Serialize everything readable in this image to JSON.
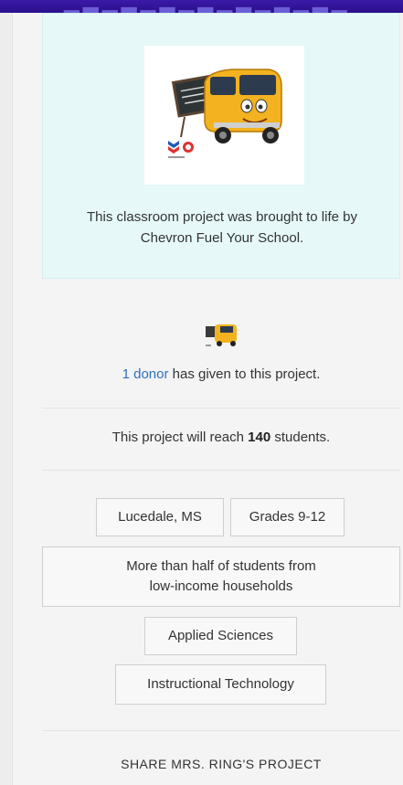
{
  "sponsor": {
    "description": "This classroom project was brought to life by Chevron Fuel Your School."
  },
  "donors": {
    "link_text": "1 donor",
    "suffix": " has given to this project."
  },
  "reach": {
    "prefix": "This project will reach ",
    "count": "140",
    "suffix": " students."
  },
  "tags": {
    "location": "Lucedale, MS",
    "grades": "Grades 9-12",
    "poverty": "More than half of students from low-income households",
    "subject_1": "Applied Sciences",
    "subject_2": "Instructional Technology"
  },
  "share": {
    "label": "SHARE MRS. RING'S PROJECT"
  },
  "colors": {
    "sponsor_bg": "#e6f8f8",
    "link": "#2f6fc0",
    "header": "#3a1aa8"
  },
  "icons": {
    "sponsor_image": "school-bus-chalkboard-illustration",
    "donor_avatar": "school-bus-thumbnail"
  }
}
